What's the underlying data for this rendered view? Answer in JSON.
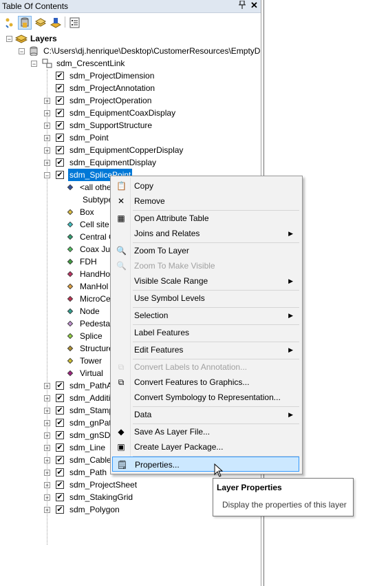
{
  "window": {
    "title": "Table Of Contents",
    "pin_glyph": "📌",
    "close_glyph": "✕"
  },
  "toolbar": {
    "buttons": [
      "list-by-drawing-order-icon",
      "list-by-source-icon",
      "list-by-visibility-icon",
      "list-by-selection-icon",
      "options-icon"
    ]
  },
  "tree": {
    "root": "Layers",
    "database": "C:\\Users\\dj.henrique\\Desktop\\CustomerResources\\EmptyD",
    "group": "sdm_CrescentLink",
    "layers_top": [
      {
        "name": "sdm_ProjectDimension",
        "expander": false
      },
      {
        "name": "sdm_ProjectAnnotation",
        "expander": false
      },
      {
        "name": "sdm_ProjectOperation",
        "expander": true
      },
      {
        "name": "sdm_EquipmentCoaxDisplay",
        "expander": true
      },
      {
        "name": "sdm_SupportStructure",
        "expander": true
      },
      {
        "name": "sdm_Point",
        "expander": true
      },
      {
        "name": "sdm_EquipmentCopperDisplay",
        "expander": true
      },
      {
        "name": "sdm_EquipmentDisplay",
        "expander": true
      }
    ],
    "selected_layer": "sdm_SplicePoint",
    "legend_header": [
      "<all othe",
      "Subtype"
    ],
    "legend_items": [
      {
        "label": "Box",
        "color": "#e0c040"
      },
      {
        "label": "Cell site",
        "color": "#40c0c0"
      },
      {
        "label": "Central C",
        "color": "#30a070"
      },
      {
        "label": "Coax Jun",
        "color": "#50c060"
      },
      {
        "label": "FDH",
        "color": "#40a040"
      },
      {
        "label": "HandHo",
        "color": "#c03060"
      },
      {
        "label": "ManHol",
        "color": "#e0a040"
      },
      {
        "label": "MicroCe",
        "color": "#c03050"
      },
      {
        "label": "Node",
        "color": "#30a090"
      },
      {
        "label": "Pedestal",
        "color": "#c090d0"
      },
      {
        "label": "Splice",
        "color": "#90d040"
      },
      {
        "label": "Structure",
        "color": "#b09030"
      },
      {
        "label": "Tower",
        "color": "#d0c030"
      },
      {
        "label": "Virtual",
        "color": "#a02080"
      }
    ],
    "layers_bottom": [
      "sdm_PathA",
      "sdm_Additi",
      "sdm_Stamp",
      "sdm_gnPat",
      "sdm_gnSDI",
      "sdm_Line",
      "sdm_Cable",
      "sdm_Path",
      "sdm_ProjectSheet",
      "sdm_StakingGrid",
      "sdm_Polygon"
    ]
  },
  "context_menu": {
    "items": [
      {
        "label": "Copy",
        "icon": "copy-icon",
        "glyph": "📋"
      },
      {
        "label": "Remove",
        "icon": "remove-icon",
        "glyph": "✕"
      },
      {
        "sep": true
      },
      {
        "label": "Open Attribute Table",
        "icon": "table-icon",
        "glyph": "▦"
      },
      {
        "label": "Joins and Relates",
        "submenu": true
      },
      {
        "sep": true
      },
      {
        "label": "Zoom To Layer",
        "icon": "zoom-layer-icon",
        "glyph": "🔍"
      },
      {
        "label": "Zoom To Make Visible",
        "icon": "zoom-visible-icon",
        "glyph": "🔍",
        "disabled": true
      },
      {
        "label": "Visible Scale Range",
        "submenu": true
      },
      {
        "sep": true
      },
      {
        "label": "Use Symbol Levels"
      },
      {
        "sep": true
      },
      {
        "label": "Selection",
        "submenu": true
      },
      {
        "sep": true
      },
      {
        "label": "Label Features"
      },
      {
        "sep": true
      },
      {
        "label": "Edit Features",
        "submenu": true
      },
      {
        "sep": true
      },
      {
        "label": "Convert Labels to Annotation...",
        "icon": "convert-labels-icon",
        "glyph": "⧉",
        "disabled": true
      },
      {
        "label": "Convert Features to Graphics...",
        "icon": "convert-graphics-icon",
        "glyph": "⧉"
      },
      {
        "label": "Convert Symbology to Representation..."
      },
      {
        "sep": true
      },
      {
        "label": "Data",
        "submenu": true
      },
      {
        "sep": true
      },
      {
        "label": "Save As Layer File...",
        "icon": "save-layer-icon",
        "glyph": "◆"
      },
      {
        "label": "Create Layer Package...",
        "icon": "layer-package-icon",
        "glyph": "▣"
      },
      {
        "sep": true
      },
      {
        "label": "Properties...",
        "icon": "properties-icon",
        "glyph": "🗒",
        "hover": true
      }
    ]
  },
  "tooltip": {
    "title": "Layer Properties",
    "body": "Display the properties of this layer"
  },
  "colors": {
    "selection": "#0078d7",
    "menu_bg": "#f2f2f2",
    "hover": "#cce8ff",
    "hover_border": "#3399ff"
  }
}
